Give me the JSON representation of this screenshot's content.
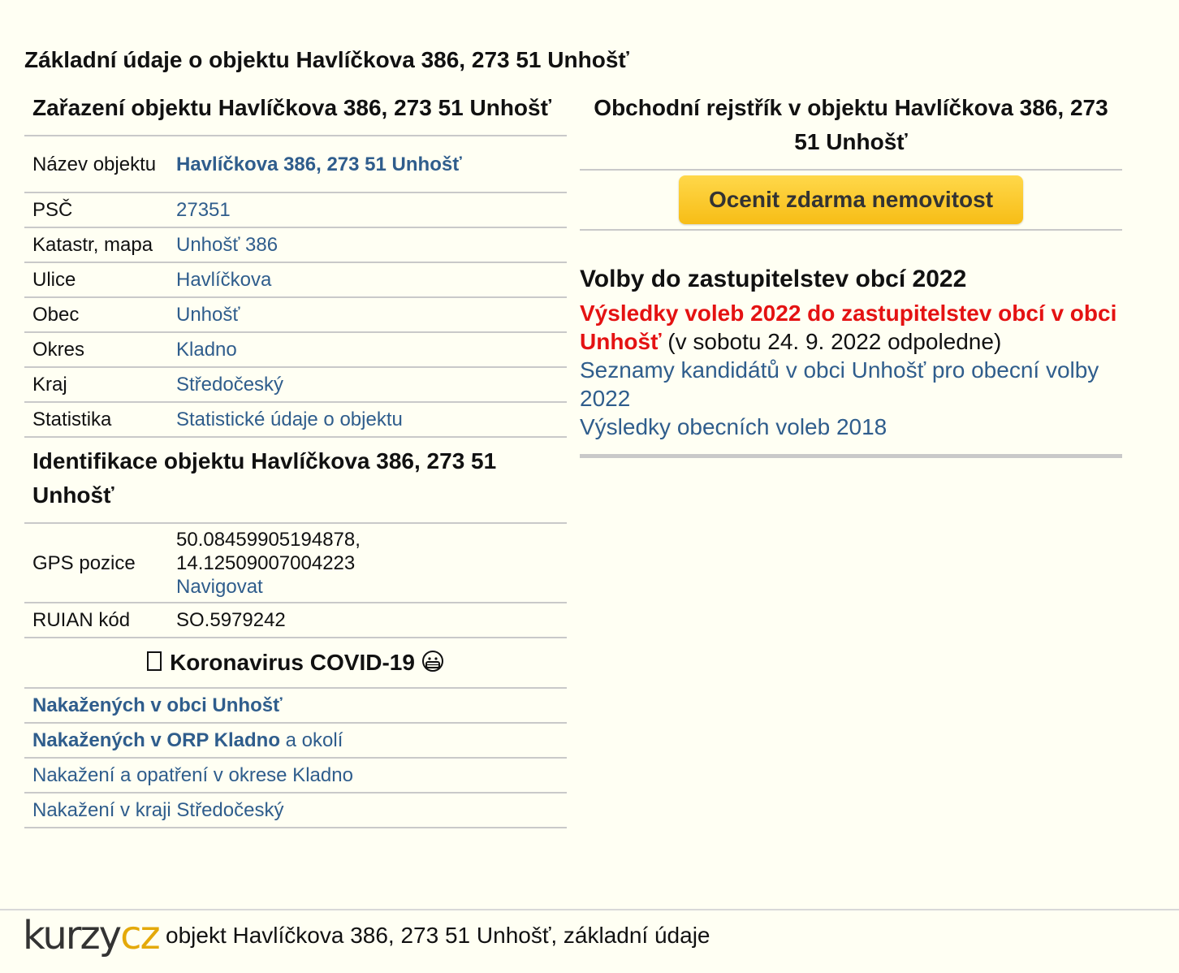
{
  "page": {
    "title": "Základní údaje o objektu Havlíčkova 386, 273 51 Unhošť"
  },
  "classification": {
    "heading": "Zařazení objektu Havlíčkova 386, 273 51 Unhošť",
    "rows": [
      {
        "label": "Název objektu",
        "value": "Havlíčkova 386, 273 51 Unhošť"
      },
      {
        "label": "PSČ",
        "value": "27351"
      },
      {
        "label": "Katastr, mapa",
        "value": "Unhošť 386"
      },
      {
        "label": "Ulice",
        "value": "Havlíčkova"
      },
      {
        "label": "Obec",
        "value": "Unhošť"
      },
      {
        "label": "Okres",
        "value": "Kladno"
      },
      {
        "label": "Kraj",
        "value": "Středočeský"
      },
      {
        "label": "Statistika",
        "value": "Statistické údaje o objektu"
      }
    ]
  },
  "identification": {
    "heading": "Identifikace objektu Havlíčkova 386, 273 51 Unhošť",
    "gps_label": "GPS pozice",
    "gps_lat": "50.08459905194878,",
    "gps_lon": "14.12509007004223",
    "navigate_link": "Navigovat",
    "ruian_label": "RUIAN kód",
    "ruian_value": "SO.5979242"
  },
  "covid": {
    "heading": "Koronavirus COVID-19",
    "icon_left": "virus-icon",
    "icon_right": "mask-face-icon",
    "row1_link": "Nakažených v obci Unhošť",
    "row2_link": "Nakažených v ORP Kladno",
    "row2_suffix": " a okolí",
    "row3_link": "Nakažení a opatření v okrese Kladno",
    "row4_link": "Nakažení v kraji Středočeský"
  },
  "business_register": {
    "heading": "Obchodní rejstřík v objektu Havlíčkova 386, 273 51 Unhošť",
    "button_label": "Ocenit zdarma nemovitost"
  },
  "elections": {
    "heading": "Volby do zastupitelstev obcí 2022",
    "results_link": "Výsledky voleb 2022 do zastupitelstev obcí v obci Unhošť",
    "results_note": " (v sobotu 24. 9. 2022 odpoledne)",
    "candidates_link": "Seznamy kandidátů v obci Unhošť pro obecní volby 2022",
    "results_2018_link": "Výsledky obecních voleb 2018"
  },
  "footer": {
    "logo_part1": "kurzy",
    "logo_part2": "cz",
    "text": "objekt Havlíčkova 386, 273 51 Unhošť, základní údaje"
  },
  "colors": {
    "background": "#fffff3",
    "link": "#2f5d8c",
    "alert_red": "#e41212",
    "button_yellow": "#f7bd16",
    "logo_accent": "#e4a90a"
  }
}
